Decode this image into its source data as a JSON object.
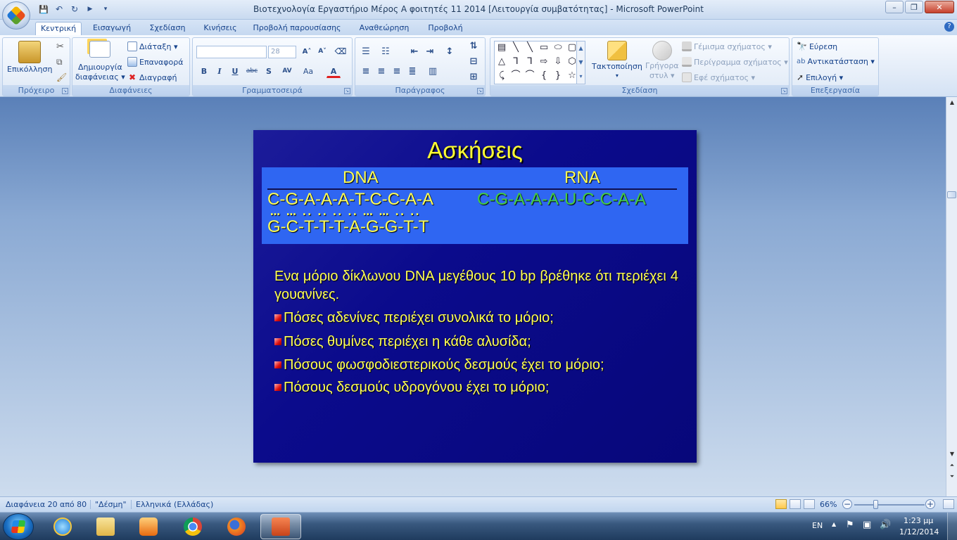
{
  "window": {
    "title": "Βιοτεχνολογία Εργαστήριο Μέρος Α φοιτητές 11 2014 [Λειτουργία συμβατότητας] - Microsoft PowerPoint",
    "minimize": "–",
    "maximize": "❐",
    "close": "✕",
    "help": "?"
  },
  "qat": {
    "save": "💾",
    "undo": "↶",
    "redo": "↻",
    "present": "▶",
    "more": "▾"
  },
  "tabs": [
    "Κεντρική",
    "Εισαγωγή",
    "Σχεδίαση",
    "Κινήσεις",
    "Προβολή παρουσίασης",
    "Αναθεώρηση",
    "Προβολή"
  ],
  "ribbon": {
    "clipboard": {
      "label": "Πρόχειρο",
      "paste": "Επικόλληση"
    },
    "slides": {
      "label": "Διαφάνειες",
      "new_slide_1": "Δημιουργία",
      "new_slide_2": "διαφάνειας ▾",
      "layout": "Διάταξη ▾",
      "reset": "Επαναφορά",
      "delete": "Διαγραφή"
    },
    "font": {
      "label": "Γραμματοσειρά",
      "font_name": "",
      "font_size": "28",
      "grow": "A˄",
      "shrink": "A˅",
      "bold": "B",
      "italic": "I",
      "underline": "U",
      "strike": "abc",
      "shadow": "S",
      "spacing": "AV",
      "case": "Aa",
      "color": "A"
    },
    "paragraph": {
      "label": "Παράγραφος"
    },
    "drawing": {
      "label": "Σχεδίαση",
      "arrange": "Τακτοποίηση",
      "quick_styles_1": "Γρήγορα",
      "quick_styles_2": "στυλ ▾",
      "fill": "Γέμισμα σχήματος ▾",
      "outline": "Περίγραμμα σχήματος ▾",
      "effects": "Εφέ σχήματος ▾"
    },
    "editing": {
      "label": "Επεξεργασία",
      "find": "Εύρεση",
      "replace": "Αντικατάσταση ▾",
      "select": "Επιλογή ▾"
    }
  },
  "slide": {
    "title": "Ασκήσεις",
    "dna_header": "DNA",
    "rna_header": "RNA",
    "dna_strand_1": "C-G-A-A-A-T-C-C-A-A",
    "dots": "… … ..  ..  ..  ..  … … ..  ..",
    "dna_strand_2": "G-C-T-T-T-A-G-G-T-T",
    "rna_strand": "C-G-A-A-A-U-C-C-A-A",
    "intro": "Ενα μόριο δίκλωνου DNA μεγέθους 10 bp βρέθηκε ότι περιέχει 4 γουανίνες.",
    "questions": [
      "Πόσες αδενίνες περιέχει συνολικά το μόριο;",
      "Πόσες θυμίνες περιέχει η κάθε αλυσίδα;",
      "Πόσους φωσφοδιεστερικούς δεσμούς έχει το μόριο;",
      "Πόσους δεσμούς υδρογόνου έχει το μόριο;"
    ]
  },
  "statusbar": {
    "slide_info": "Διαφάνεια 20 από 80",
    "theme": "\"Δέσμη\"",
    "language": "Ελληνικά (Ελλάδας)",
    "zoom": "66%",
    "zoom_out": "−",
    "zoom_in": "+"
  },
  "taskbar": {
    "lang": "EN",
    "time": "1:23 μμ",
    "date": "1/12/2014"
  },
  "colors": {
    "slide_bg": "#0b0b8c",
    "seq_box": "#2f66f2",
    "text_yellow": "#ffff55",
    "rna_green": "#44cc44",
    "bullet_red": "#e01010"
  }
}
